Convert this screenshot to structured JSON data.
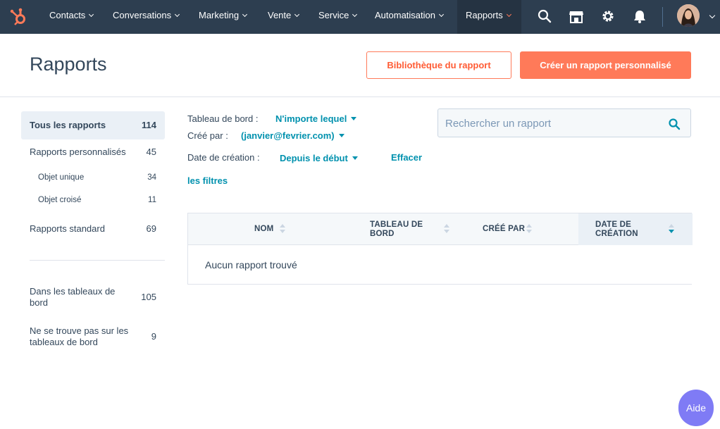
{
  "nav": {
    "items": [
      {
        "label": "Contacts"
      },
      {
        "label": "Conversations"
      },
      {
        "label": "Marketing"
      },
      {
        "label": "Vente"
      },
      {
        "label": "Service"
      },
      {
        "label": "Automatisation"
      },
      {
        "label": "Rapports"
      }
    ],
    "accent": "#ff7a59",
    "bg": "#2d3e50"
  },
  "header": {
    "title": "Rapports",
    "library_button": "Bibliothèque du rapport",
    "create_button": "Créer un rapport personnalisé"
  },
  "sidebar": {
    "all": {
      "label": "Tous les rapports",
      "count": "114"
    },
    "custom": {
      "label": "Rapports personnalisés",
      "count": "45"
    },
    "single": {
      "label": "Objet unique",
      "count": "34"
    },
    "cross": {
      "label": "Objet croisé",
      "count": "11"
    },
    "standard": {
      "label": "Rapports standard",
      "count": "69"
    },
    "in_dash_1": "Dans les tableaux de",
    "in_dash_2": "bord",
    "in_dash_count": "105",
    "not_dash_1": "Ne se trouve pas sur les",
    "not_dash_2": "tableaux de bord",
    "not_dash_count": "9"
  },
  "filters": {
    "dashboard_label": "Tableau de bord :",
    "dashboard_value": "N'importe lequel",
    "created_by_label": "Créé par :",
    "created_by_value": "(janvier@fevrier.com)",
    "date_label": "Date de création :",
    "date_value": "Depuis le début",
    "clear_1": "Effacer",
    "clear_2": "les filtres"
  },
  "search": {
    "placeholder": "Rechercher un rapport"
  },
  "table": {
    "col_name": "NOM",
    "col_dash_1": "TABLEAU DE",
    "col_dash_2": "BORD",
    "col_created_by": "CRÉÉ PAR",
    "col_date_1": "DATE DE",
    "col_date_2": "CRÉATION",
    "empty": "Aucun rapport trouvé"
  },
  "help": {
    "label": "Aide"
  }
}
